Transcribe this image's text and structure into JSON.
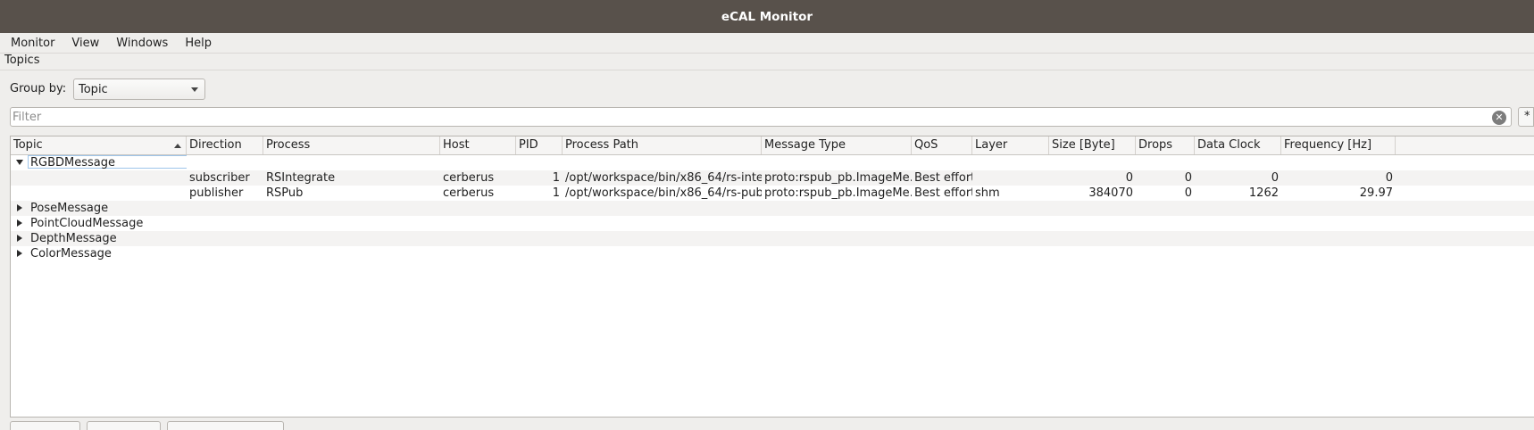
{
  "window": {
    "title": "eCAL Monitor"
  },
  "menu": [
    "Monitor",
    "View",
    "Windows",
    "Help"
  ],
  "dock": {
    "title": "Topics"
  },
  "group_by": {
    "label": "Group by:",
    "value": "Topic"
  },
  "filter": {
    "placeholder": "Filter",
    "regex_label": "*"
  },
  "table": {
    "columns": [
      "Topic",
      "Direction",
      "Process",
      "Host",
      "PID",
      "Process Path",
      "Message Type",
      "QoS",
      "Layer",
      "Size [Byte]",
      "Drops",
      "Data Clock",
      "Frequency [Hz]"
    ],
    "groups": [
      {
        "name": "RGBDMessage",
        "expanded": true,
        "rows": [
          {
            "direction": "subscriber",
            "process": "RSIntegrate",
            "host": "cerberus",
            "pid": "1",
            "path": "/opt/workspace/bin/x86_64/rs-inte…",
            "type": "proto:rspub_pb.ImageMe…",
            "qos": "Best effort",
            "layer": "",
            "size": "0",
            "drops": "0",
            "clock": "0",
            "freq": "0"
          },
          {
            "direction": "publisher",
            "process": "RSPub",
            "host": "cerberus",
            "pid": "1",
            "path": "/opt/workspace/bin/x86_64/rs-pub",
            "type": "proto:rspub_pb.ImageMe…",
            "qos": "Best effort",
            "layer": "shm",
            "size": "384070",
            "drops": "0",
            "clock": "1262",
            "freq": "29.97"
          }
        ]
      },
      {
        "name": "PoseMessage",
        "expanded": false
      },
      {
        "name": "PointCloudMessage",
        "expanded": false
      },
      {
        "name": "DepthMessage",
        "expanded": false
      },
      {
        "name": "ColorMessage",
        "expanded": false
      }
    ]
  },
  "colors": {
    "titlebar": "#58514b",
    "selection_border": "#9ec5ea"
  }
}
